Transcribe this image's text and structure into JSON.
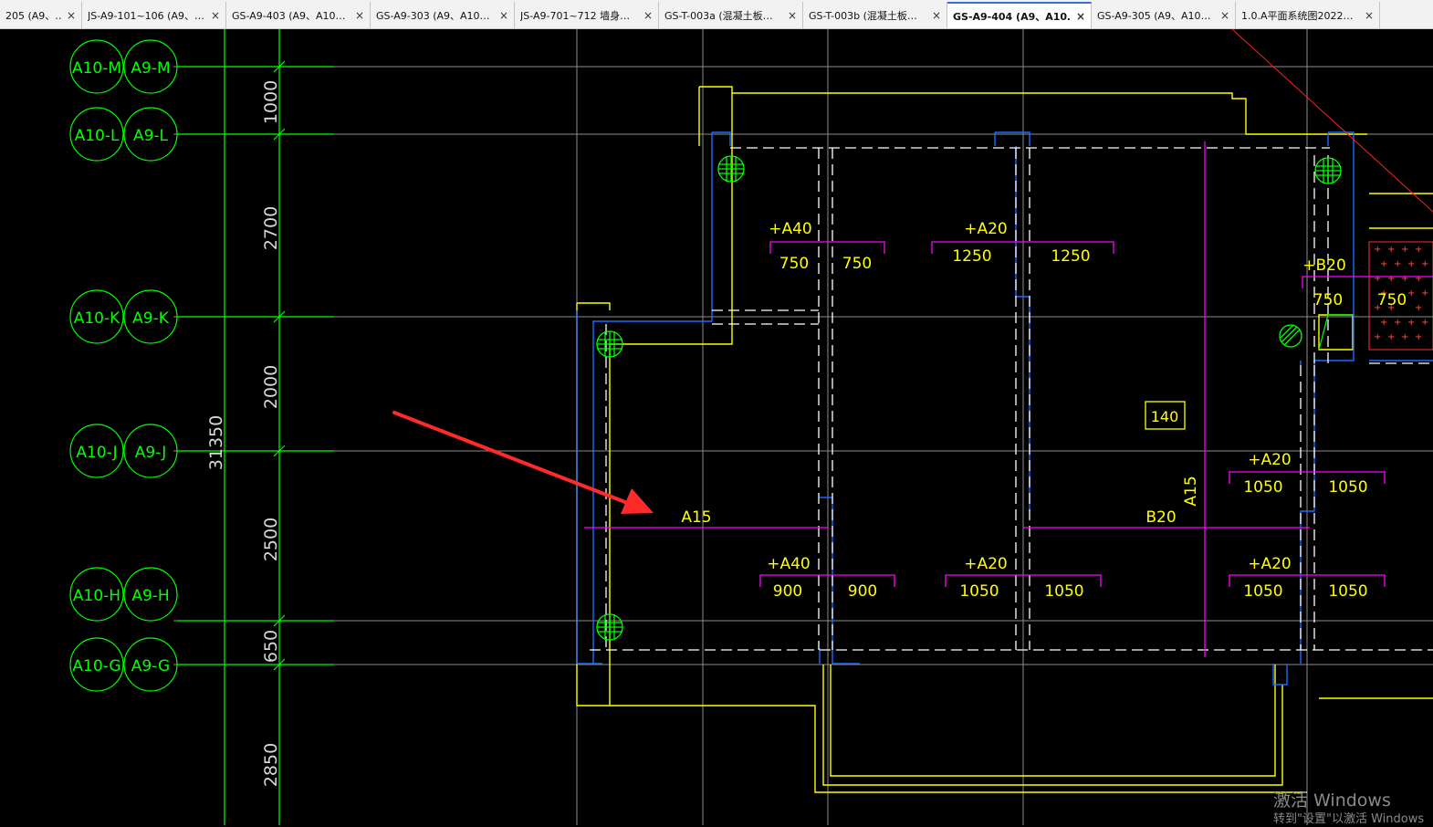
{
  "tabs": [
    {
      "label": "205 (A9、…",
      "active": false
    },
    {
      "label": "JS-A9-101~106 (A9、…",
      "active": false
    },
    {
      "label": "GS-A9-403 (A9、A10…",
      "active": false
    },
    {
      "label": "GS-A9-303 (A9、A10…",
      "active": false
    },
    {
      "label": "JS-A9-701~712 墙身…",
      "active": false
    },
    {
      "label": "GS-T-003a (混凝土板…",
      "active": false
    },
    {
      "label": "GS-T-003b (混凝土板…",
      "active": false
    },
    {
      "label": "GS-A9-404 (A9、A10…",
      "active": true
    },
    {
      "label": "GS-A9-305 (A9、A10…",
      "active": false
    },
    {
      "label": "1.0.A平面系统图2022…",
      "active": false
    }
  ],
  "tab_close_glyph": "×",
  "axes": [
    {
      "left": "A10-M",
      "right": "A9-M"
    },
    {
      "left": "A10-L",
      "right": "A9-L"
    },
    {
      "left": "A10-K",
      "right": "A9-K"
    },
    {
      "left": "A10-J",
      "right": "A9-J"
    },
    {
      "left": "A10-H",
      "right": "A9-H"
    },
    {
      "left": "A10-G",
      "right": "A9-G"
    }
  ],
  "dimensions": {
    "total": "31350",
    "segments": [
      "1000",
      "2700",
      "2000",
      "2500",
      "650",
      "2850"
    ]
  },
  "annotations": {
    "top_left_offset": "+A40",
    "top_left_a": "750",
    "top_left_b": "750",
    "top_mid_offset": "+A20",
    "top_mid_a": "1250",
    "top_mid_b": "1250",
    "right_top_offset": "+B20",
    "right_top_a": "750",
    "right_top_b": "750",
    "slab_label": "140",
    "right_mid_offset": "+A20",
    "right_mid_a": "1050",
    "right_mid_b": "1050",
    "beam_left": "A15",
    "beam_right": "B20",
    "beam_vertical": "A15",
    "bot_left_offset": "+A40",
    "bot_left_a": "900",
    "bot_left_b": "900",
    "bot_mid_offset": "+A20",
    "bot_mid_a": "1050",
    "bot_mid_b": "1050",
    "bot_right_offset": "+A20",
    "bot_right_a": "1050",
    "bot_right_b": "1050"
  },
  "watermark": {
    "line1": "激活 Windows",
    "line2": "转到\"设置\"以激活 Windows"
  },
  "colors": {
    "background": "#000000",
    "axis_green": "#00ff00",
    "wall_yellow": "#ffff00",
    "wall_blue": "#1e6bff",
    "rebar_magenta": "#ff00ff",
    "gridline_gray": "#8c8c8c",
    "arrow_red": "#ff2a2a",
    "dashed_white": "#ffffff"
  }
}
